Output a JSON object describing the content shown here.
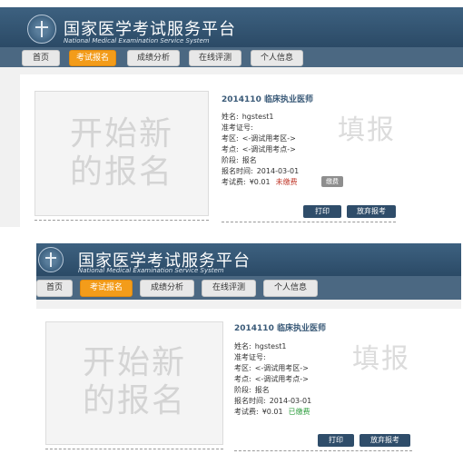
{
  "site": {
    "title_cn": "国家医学考试服务平台",
    "title_en": "National Medical Examination Service System"
  },
  "nav": {
    "items": [
      {
        "label": "首页"
      },
      {
        "label": "考试报名"
      },
      {
        "label": "成绩分析"
      },
      {
        "label": "在线评测"
      },
      {
        "label": "个人信息"
      }
    ],
    "active": "考试报名"
  },
  "registration": {
    "placeholder_line1": "开始新",
    "placeholder_line2": "的报名",
    "fill_hint": "填报",
    "exam_title": "2014110 临床执业医师",
    "name_label": "姓名:",
    "name_value": "hgstest1",
    "ticket_label": "准考证号:",
    "ticket_value": "",
    "area_label": "考区:",
    "area_value": "<-调试用考区->",
    "site_label": "考点:",
    "site_value": "<-调试用考点->",
    "stage_label": "阶段:",
    "stage_value": "报名",
    "time_label": "报名时间:",
    "time_value": "2014-03-01",
    "fee_label": "考试费:",
    "fee_value": "¥0.01",
    "print_button": "打印",
    "abandon_button": "放弃报考"
  },
  "before": {
    "status": "未缴费",
    "pay_button": "缴费"
  },
  "after": {
    "status": "已缴费"
  },
  "colors": {
    "header": "#3d6180",
    "navbar": "#4b6882",
    "active_tab": "#f39c1a",
    "unpaid": "#c0392b",
    "paid": "#2e9e3e",
    "action_button": "#2f4d6a"
  }
}
